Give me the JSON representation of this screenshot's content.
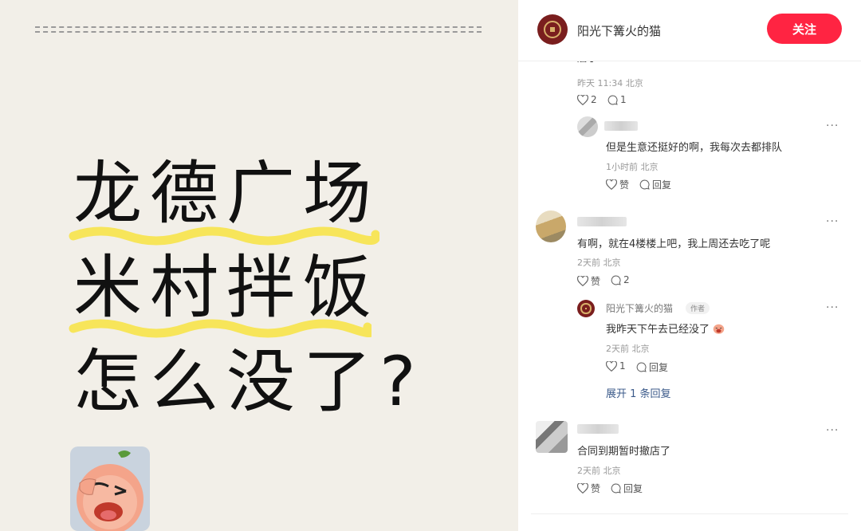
{
  "image_panel": {
    "line1": "龙德广场",
    "line2": "米村拌饭",
    "line3": "怎么没了?"
  },
  "header": {
    "author_name": "阳光下篝火的猫",
    "follow_label": "关注"
  },
  "comments": [
    {
      "partial_text": "店了",
      "meta": "昨天 11:34 北京",
      "like_count": "2",
      "reply_count": "1",
      "replies": [
        {
          "text": "但是生意还挺好的啊，我每次去都排队",
          "meta": "1小时前 北京",
          "like_label": "赞",
          "reply_label": "回复"
        }
      ]
    },
    {
      "text": "有啊，就在4楼楼上吧，我上周还去吃了呢",
      "meta": "2天前 北京",
      "like_label": "赞",
      "reply_count": "2",
      "replies": [
        {
          "author": "阳光下篝火的猫",
          "badge": "作者",
          "text": "我昨天下午去已经没了",
          "meta": "2天前 北京",
          "like_count": "1",
          "reply_label": "回复"
        }
      ],
      "expand_label": "展开 1 条回复"
    },
    {
      "text": "合同到期暂时撤店了",
      "meta": "2天前 北京",
      "like_label": "赞",
      "reply_label": "回复"
    }
  ],
  "more_label": "···",
  "colors": {
    "accent": "#ff2442",
    "highlight": "#f7e55a",
    "link": "#3b5a8a"
  }
}
